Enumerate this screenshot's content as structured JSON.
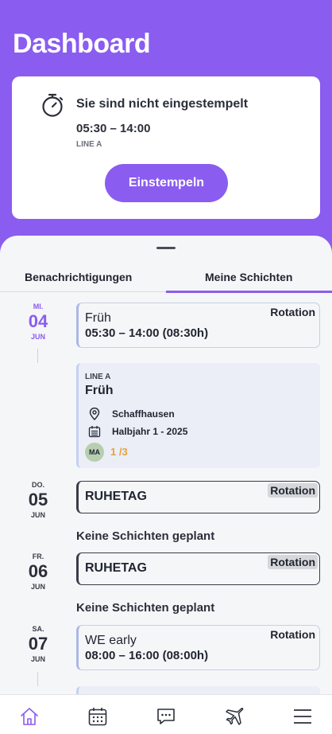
{
  "header": {
    "title": "Dashboard"
  },
  "clock_card": {
    "status": "Sie sind nicht eingestempelt",
    "time": "05:30 – 14:00",
    "line": "LINE A",
    "button_label": "Einstempeln"
  },
  "tabs": [
    "Benachrichtigungen",
    "Meine Schichten"
  ],
  "days": [
    {
      "dow": "MI.",
      "num": "04",
      "mon": "JUN",
      "shift": {
        "name": "Früh",
        "times": "05:30 – 14:00 (08:30h)",
        "badge": "Rotation"
      },
      "detail": {
        "line": "LINE A",
        "name": "Früh",
        "location": "Schaffhausen",
        "period": "Halbjahr 1 - 2025",
        "avatar": "MA",
        "count": "1 /3"
      }
    },
    {
      "dow": "DO.",
      "num": "05",
      "mon": "JUN",
      "shift": {
        "name": "RUHETAG",
        "badge": "Rotation"
      },
      "note": "Keine Schichten geplant"
    },
    {
      "dow": "FR.",
      "num": "06",
      "mon": "JUN",
      "shift": {
        "name": "RUHETAG",
        "badge": "Rotation"
      },
      "note": "Keine Schichten geplant"
    },
    {
      "dow": "SA.",
      "num": "07",
      "mon": "JUN",
      "shift": {
        "name": "WE early",
        "times": "08:00 – 16:00 (08:00h)",
        "badge": "Rotation"
      }
    }
  ],
  "nav": [
    "home-icon",
    "calendar-icon",
    "chat-icon",
    "plane-icon",
    "menu-icon"
  ],
  "colors": {
    "accent": "#8a5cf0",
    "count": "#e8a23a"
  }
}
